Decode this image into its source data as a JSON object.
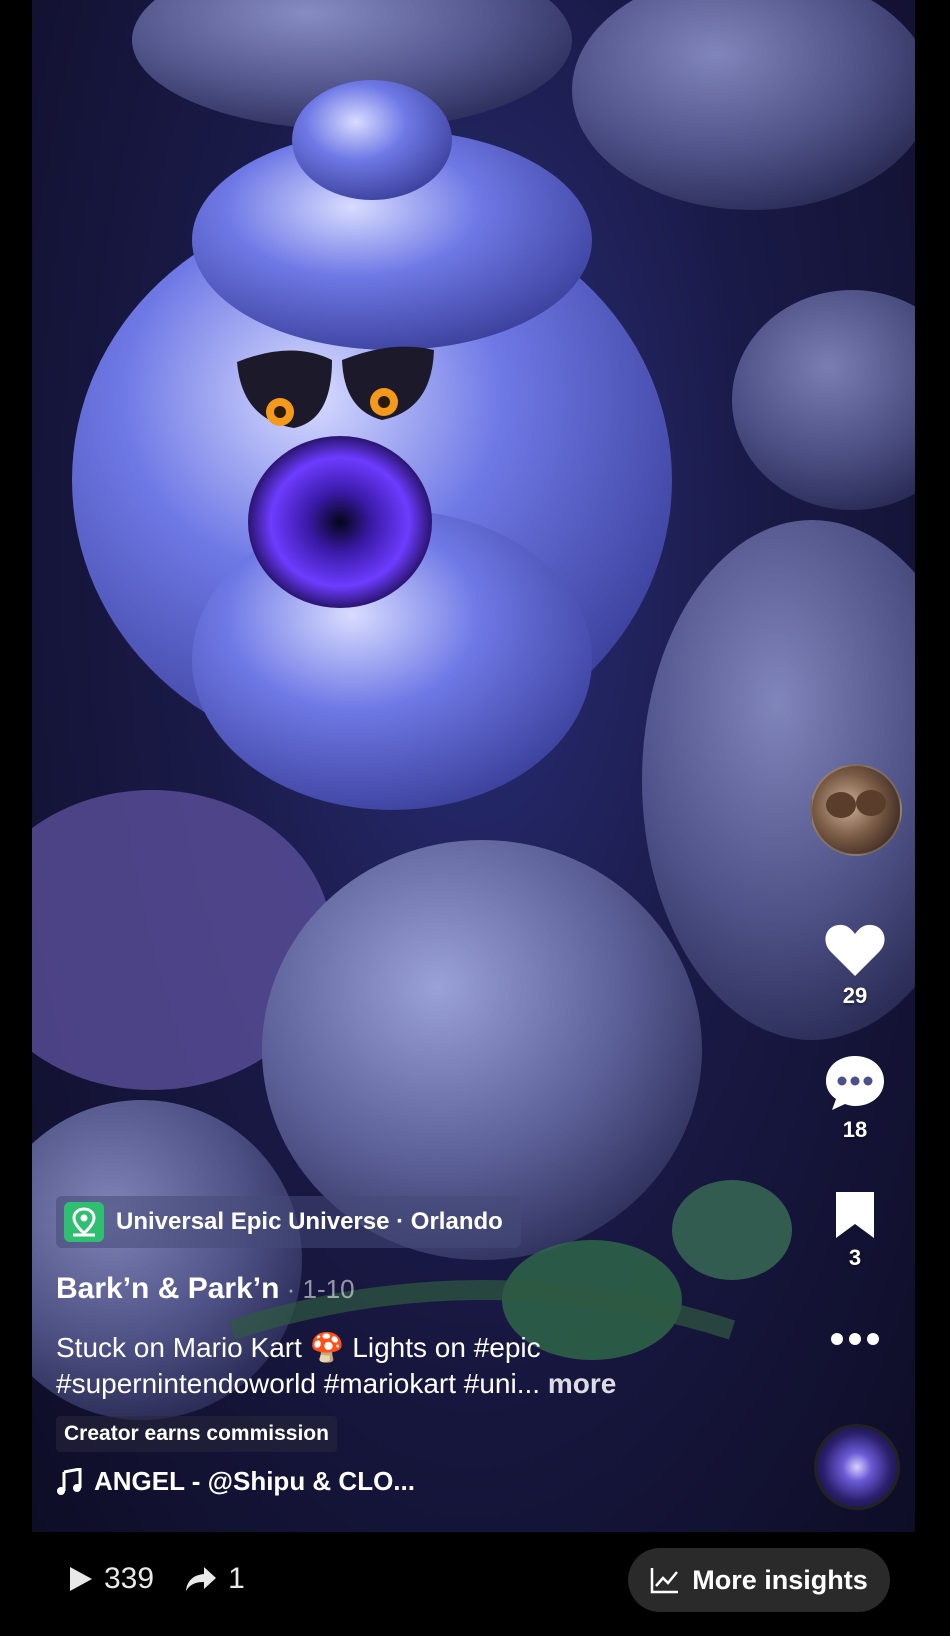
{
  "rail": {
    "likes": "29",
    "comments": "18",
    "saves": "3"
  },
  "location": {
    "label": "Universal Epic Universe · Orlando"
  },
  "post": {
    "title": "Bark’n & Park’n",
    "date": " · 1-10",
    "caption_line1": "Stuck on Mario Kart 🍄 Lights on #epic",
    "caption_line2": "#supernintendoworld #mariokart #uni...",
    "more": "more",
    "commission": "Creator earns commission",
    "music": "ANGEL - @Shipu & CLO..."
  },
  "stats": {
    "views": "339",
    "shares": "1"
  },
  "insights": {
    "label": "More insights"
  }
}
